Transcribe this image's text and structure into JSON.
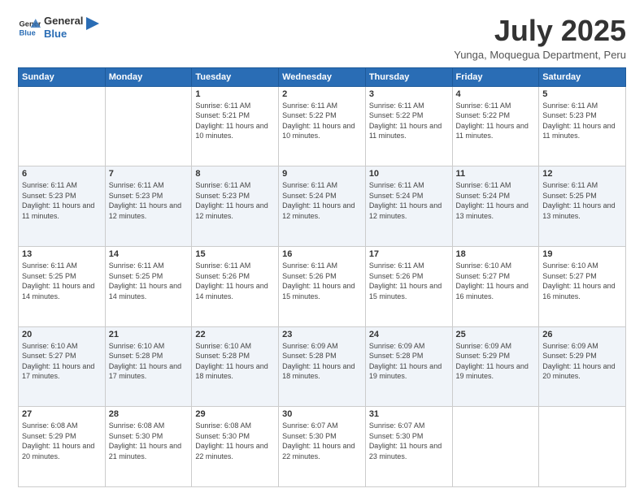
{
  "logo": {
    "general": "General",
    "blue": "Blue"
  },
  "title": "July 2025",
  "location": "Yunga, Moquegua Department, Peru",
  "days_of_week": [
    "Sunday",
    "Monday",
    "Tuesday",
    "Wednesday",
    "Thursday",
    "Friday",
    "Saturday"
  ],
  "weeks": [
    [
      {
        "day": "",
        "info": ""
      },
      {
        "day": "",
        "info": ""
      },
      {
        "day": "1",
        "info": "Sunrise: 6:11 AM\nSunset: 5:21 PM\nDaylight: 11 hours and 10 minutes."
      },
      {
        "day": "2",
        "info": "Sunrise: 6:11 AM\nSunset: 5:22 PM\nDaylight: 11 hours and 10 minutes."
      },
      {
        "day": "3",
        "info": "Sunrise: 6:11 AM\nSunset: 5:22 PM\nDaylight: 11 hours and 11 minutes."
      },
      {
        "day": "4",
        "info": "Sunrise: 6:11 AM\nSunset: 5:22 PM\nDaylight: 11 hours and 11 minutes."
      },
      {
        "day": "5",
        "info": "Sunrise: 6:11 AM\nSunset: 5:23 PM\nDaylight: 11 hours and 11 minutes."
      }
    ],
    [
      {
        "day": "6",
        "info": "Sunrise: 6:11 AM\nSunset: 5:23 PM\nDaylight: 11 hours and 11 minutes."
      },
      {
        "day": "7",
        "info": "Sunrise: 6:11 AM\nSunset: 5:23 PM\nDaylight: 11 hours and 12 minutes."
      },
      {
        "day": "8",
        "info": "Sunrise: 6:11 AM\nSunset: 5:23 PM\nDaylight: 11 hours and 12 minutes."
      },
      {
        "day": "9",
        "info": "Sunrise: 6:11 AM\nSunset: 5:24 PM\nDaylight: 11 hours and 12 minutes."
      },
      {
        "day": "10",
        "info": "Sunrise: 6:11 AM\nSunset: 5:24 PM\nDaylight: 11 hours and 12 minutes."
      },
      {
        "day": "11",
        "info": "Sunrise: 6:11 AM\nSunset: 5:24 PM\nDaylight: 11 hours and 13 minutes."
      },
      {
        "day": "12",
        "info": "Sunrise: 6:11 AM\nSunset: 5:25 PM\nDaylight: 11 hours and 13 minutes."
      }
    ],
    [
      {
        "day": "13",
        "info": "Sunrise: 6:11 AM\nSunset: 5:25 PM\nDaylight: 11 hours and 14 minutes."
      },
      {
        "day": "14",
        "info": "Sunrise: 6:11 AM\nSunset: 5:25 PM\nDaylight: 11 hours and 14 minutes."
      },
      {
        "day": "15",
        "info": "Sunrise: 6:11 AM\nSunset: 5:26 PM\nDaylight: 11 hours and 14 minutes."
      },
      {
        "day": "16",
        "info": "Sunrise: 6:11 AM\nSunset: 5:26 PM\nDaylight: 11 hours and 15 minutes."
      },
      {
        "day": "17",
        "info": "Sunrise: 6:11 AM\nSunset: 5:26 PM\nDaylight: 11 hours and 15 minutes."
      },
      {
        "day": "18",
        "info": "Sunrise: 6:10 AM\nSunset: 5:27 PM\nDaylight: 11 hours and 16 minutes."
      },
      {
        "day": "19",
        "info": "Sunrise: 6:10 AM\nSunset: 5:27 PM\nDaylight: 11 hours and 16 minutes."
      }
    ],
    [
      {
        "day": "20",
        "info": "Sunrise: 6:10 AM\nSunset: 5:27 PM\nDaylight: 11 hours and 17 minutes."
      },
      {
        "day": "21",
        "info": "Sunrise: 6:10 AM\nSunset: 5:28 PM\nDaylight: 11 hours and 17 minutes."
      },
      {
        "day": "22",
        "info": "Sunrise: 6:10 AM\nSunset: 5:28 PM\nDaylight: 11 hours and 18 minutes."
      },
      {
        "day": "23",
        "info": "Sunrise: 6:09 AM\nSunset: 5:28 PM\nDaylight: 11 hours and 18 minutes."
      },
      {
        "day": "24",
        "info": "Sunrise: 6:09 AM\nSunset: 5:28 PM\nDaylight: 11 hours and 19 minutes."
      },
      {
        "day": "25",
        "info": "Sunrise: 6:09 AM\nSunset: 5:29 PM\nDaylight: 11 hours and 19 minutes."
      },
      {
        "day": "26",
        "info": "Sunrise: 6:09 AM\nSunset: 5:29 PM\nDaylight: 11 hours and 20 minutes."
      }
    ],
    [
      {
        "day": "27",
        "info": "Sunrise: 6:08 AM\nSunset: 5:29 PM\nDaylight: 11 hours and 20 minutes."
      },
      {
        "day": "28",
        "info": "Sunrise: 6:08 AM\nSunset: 5:30 PM\nDaylight: 11 hours and 21 minutes."
      },
      {
        "day": "29",
        "info": "Sunrise: 6:08 AM\nSunset: 5:30 PM\nDaylight: 11 hours and 22 minutes."
      },
      {
        "day": "30",
        "info": "Sunrise: 6:07 AM\nSunset: 5:30 PM\nDaylight: 11 hours and 22 minutes."
      },
      {
        "day": "31",
        "info": "Sunrise: 6:07 AM\nSunset: 5:30 PM\nDaylight: 11 hours and 23 minutes."
      },
      {
        "day": "",
        "info": ""
      },
      {
        "day": "",
        "info": ""
      }
    ]
  ]
}
